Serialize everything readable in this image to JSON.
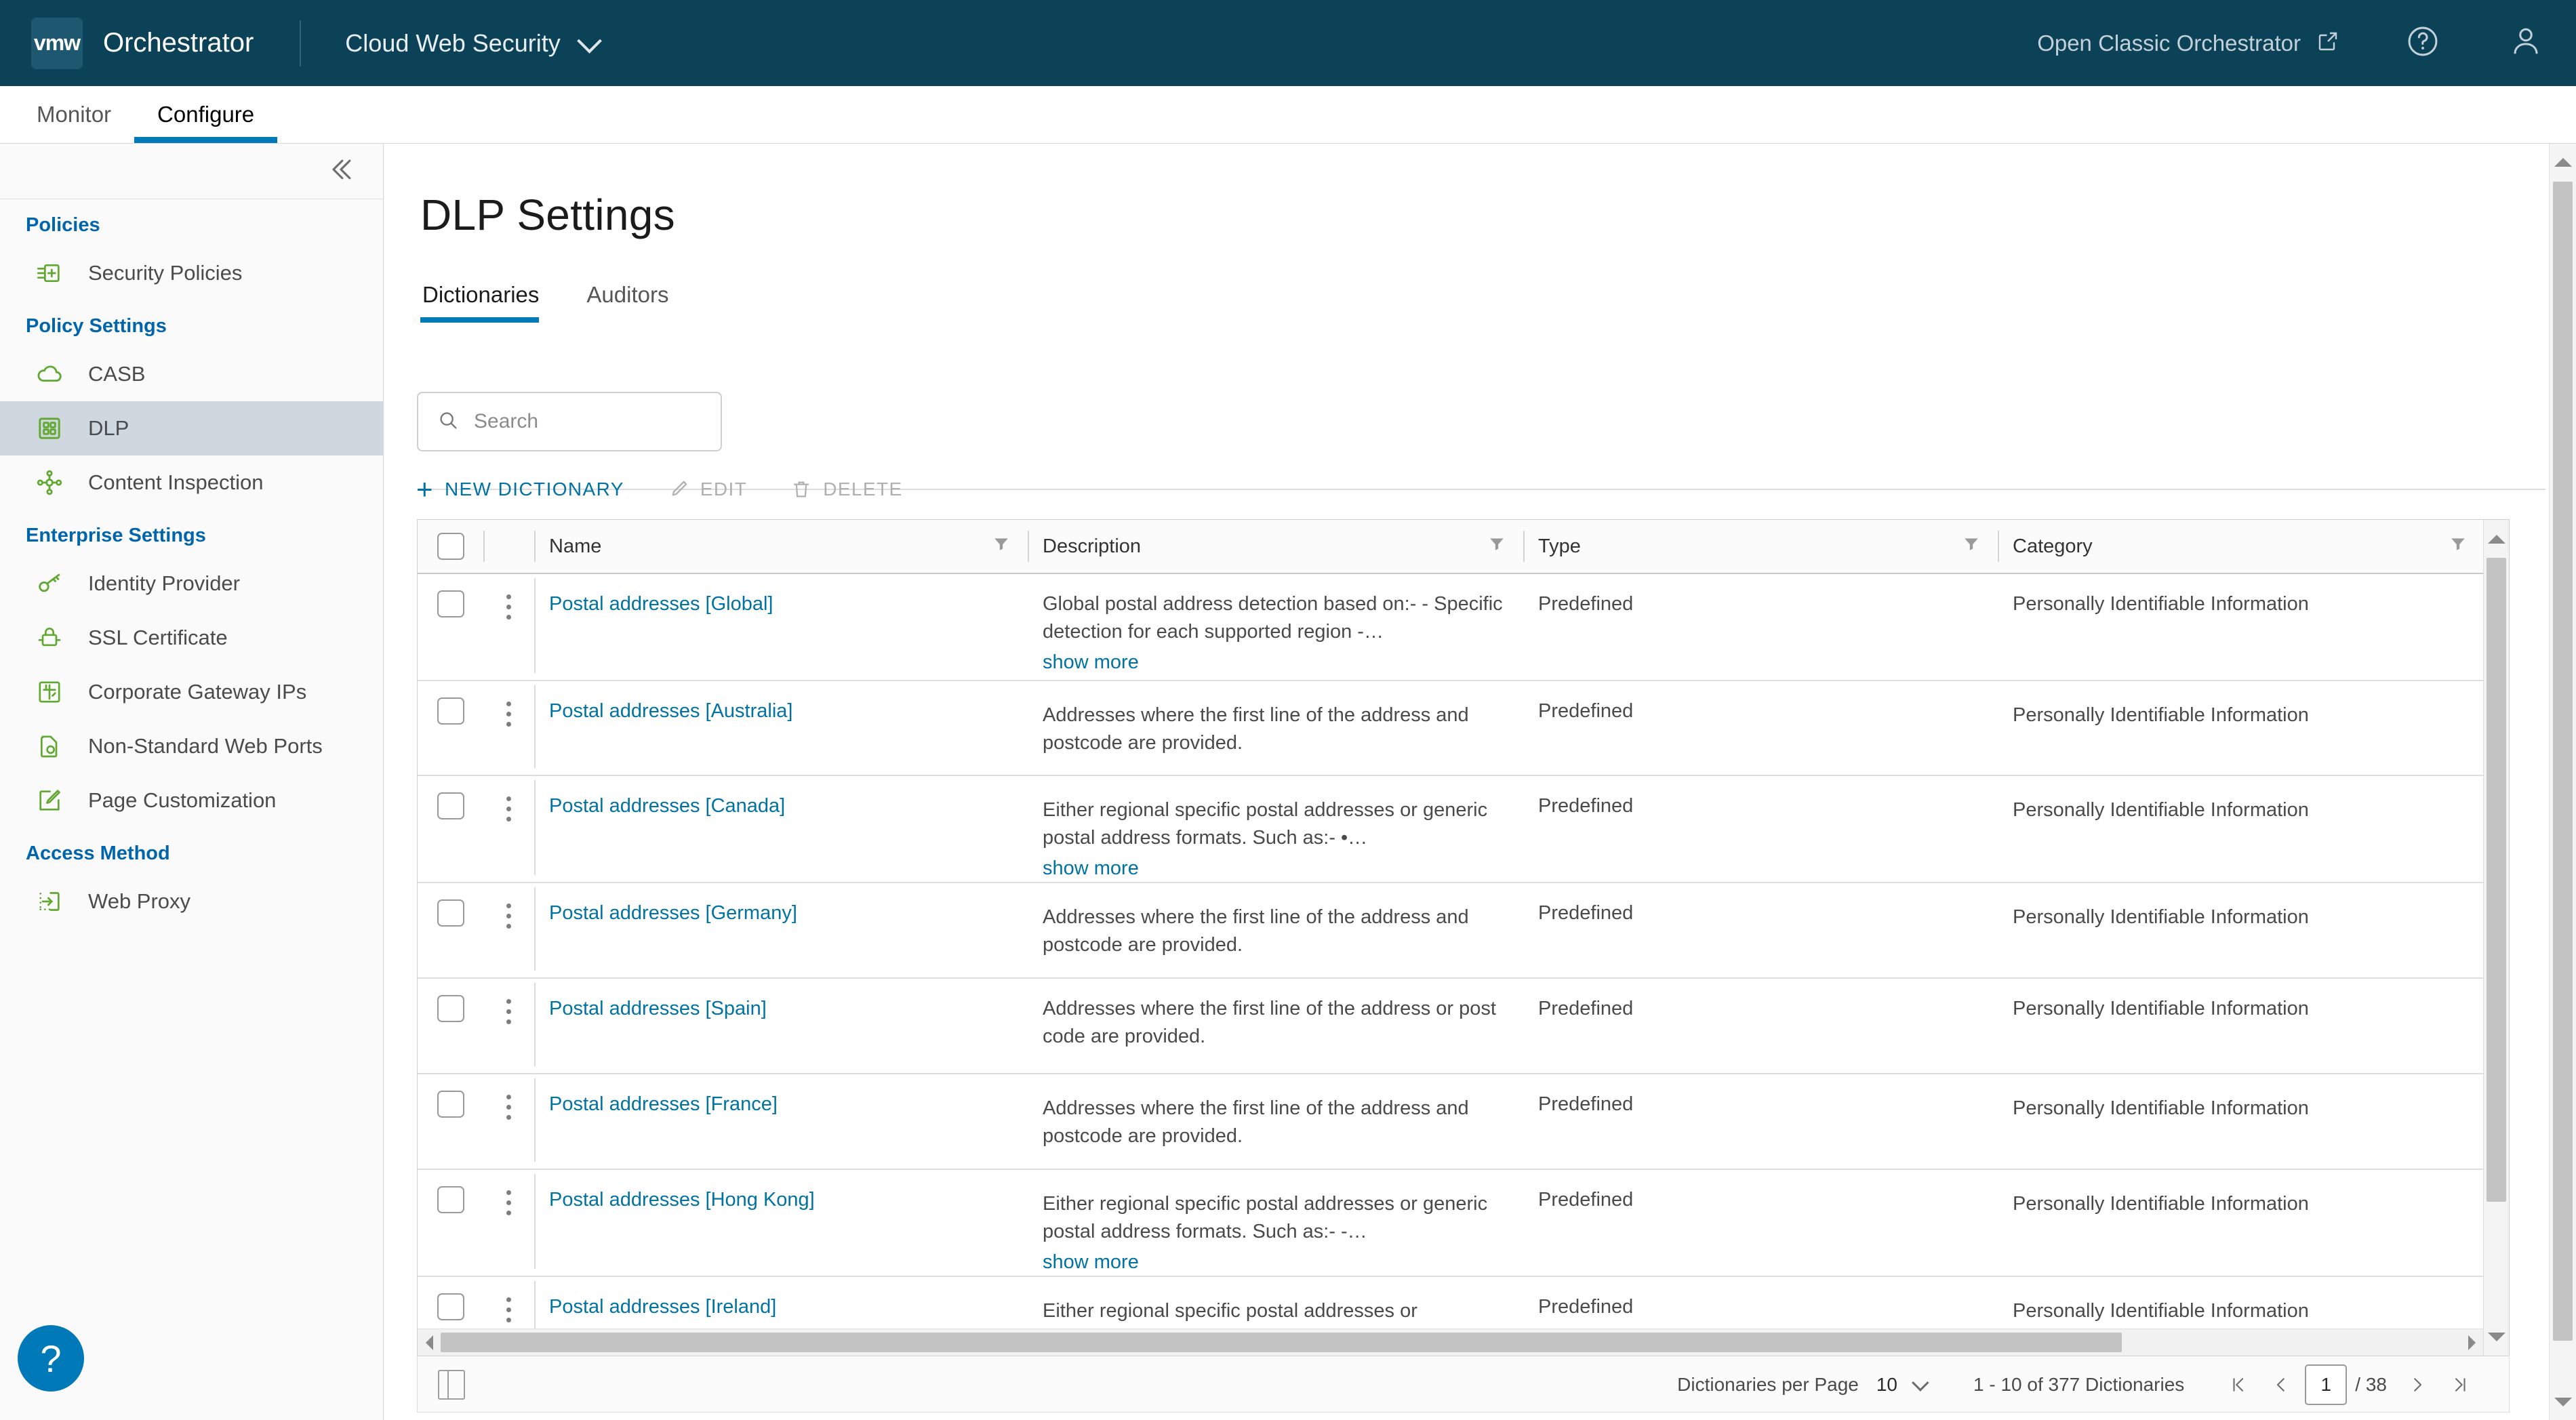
{
  "header": {
    "logo_text": "vmw",
    "app_title": "Orchestrator",
    "service": "Cloud Web Security",
    "open_classic": "Open Classic Orchestrator",
    "icons": {
      "external_link": "external-link-icon",
      "help": "help-icon",
      "user": "user-avatar-icon"
    },
    "brand_color": "#0b4258",
    "accent_color": "#0079b8"
  },
  "nav_tabs": [
    {
      "label": "Monitor",
      "active": false
    },
    {
      "label": "Configure",
      "active": true
    }
  ],
  "sidebar": {
    "collapse_icon": "double-chevron-left-icon",
    "groups": [
      {
        "label": "Policies",
        "items": [
          {
            "label": "Security Policies",
            "icon": "policy-add-icon",
            "active": false
          }
        ]
      },
      {
        "label": "Policy Settings",
        "items": [
          {
            "label": "CASB",
            "icon": "cloud-icon",
            "active": false
          },
          {
            "label": "DLP",
            "icon": "grid-squares-icon",
            "active": true
          },
          {
            "label": "Content Inspection",
            "icon": "node-network-icon",
            "active": false
          }
        ]
      },
      {
        "label": "Enterprise Settings",
        "items": [
          {
            "label": "Identity Provider",
            "icon": "key-icon",
            "active": false
          },
          {
            "label": "SSL Certificate",
            "icon": "lock-certificate-icon",
            "active": false
          },
          {
            "label": "Corporate Gateway IPs",
            "icon": "gateway-icon",
            "active": false
          },
          {
            "label": "Non-Standard Web Ports",
            "icon": "page-gear-icon",
            "active": false
          },
          {
            "label": "Page Customization",
            "icon": "pencil-page-icon",
            "active": false
          }
        ]
      },
      {
        "label": "Access Method",
        "items": [
          {
            "label": "Web Proxy",
            "icon": "proxy-arrow-icon",
            "active": false
          }
        ]
      }
    ],
    "help_fab": "?"
  },
  "main": {
    "page_title": "DLP Settings",
    "tabs": [
      {
        "label": "Dictionaries",
        "active": true
      },
      {
        "label": "Auditors",
        "active": false
      }
    ],
    "search": {
      "placeholder": "Search",
      "value": "",
      "icon": "search-icon"
    },
    "actions": [
      {
        "label": "NEW DICTIONARY",
        "icon": "plus-icon",
        "enabled": true
      },
      {
        "label": "EDIT",
        "icon": "pencil-icon",
        "enabled": false
      },
      {
        "label": "DELETE",
        "icon": "trash-icon",
        "enabled": false
      }
    ],
    "table": {
      "columns": [
        {
          "key": "name",
          "label": "Name",
          "filterable": true
        },
        {
          "key": "description",
          "label": "Description",
          "filterable": true
        },
        {
          "key": "type",
          "label": "Type",
          "filterable": true
        },
        {
          "key": "category",
          "label": "Category",
          "filterable": true
        }
      ],
      "select_all_checked": false,
      "rows": [
        {
          "name": "Postal addresses [Global]",
          "description": "Global postal address detection based on:- - Specific detection for each supported region -…",
          "show_more": "show more",
          "type": "Predefined",
          "category": "Personally Identifiable Information"
        },
        {
          "name": "Postal addresses [Australia]",
          "description": "Addresses where the first line of the address and postcode are provided.",
          "show_more": "",
          "type": "Predefined",
          "category": "Personally Identifiable Information"
        },
        {
          "name": "Postal addresses [Canada]",
          "description": "Either regional specific postal addresses or generic postal address formats. Such as:- •…",
          "show_more": "show more",
          "type": "Predefined",
          "category": "Personally Identifiable Information"
        },
        {
          "name": "Postal addresses [Germany]",
          "description": "Addresses where the first line of the address and postcode are provided.",
          "show_more": "",
          "type": "Predefined",
          "category": "Personally Identifiable Information"
        },
        {
          "name": "Postal addresses [Spain]",
          "description": "Addresses where the first line of the address or post code are provided.",
          "show_more": "",
          "type": "Predefined",
          "category": "Personally Identifiable Information"
        },
        {
          "name": "Postal addresses [France]",
          "description": "Addresses where the first line of the address and postcode are provided.",
          "show_more": "",
          "type": "Predefined",
          "category": "Personally Identifiable Information"
        },
        {
          "name": "Postal addresses [Hong Kong]",
          "description": "Either regional specific postal addresses or generic postal address formats. Such as:- -…",
          "show_more": "show more",
          "type": "Predefined",
          "category": "Personally Identifiable Information"
        },
        {
          "name": "Postal addresses [Ireland]",
          "description": "Either regional specific postal addresses or",
          "show_more": "",
          "type": "Predefined",
          "category": "Personally Identifiable Information"
        }
      ]
    },
    "footer": {
      "column_toggle_icon": "column-toggle-icon",
      "per_page_label": "Dictionaries per Page",
      "per_page_value": "10",
      "range_text": "1 - 10 of 377 Dictionaries",
      "first_icon": "first-page-icon",
      "prev_icon": "prev-page-icon",
      "page_value": "1",
      "page_total": "/ 38",
      "next_icon": "next-page-icon",
      "last_icon": "last-page-icon"
    }
  }
}
